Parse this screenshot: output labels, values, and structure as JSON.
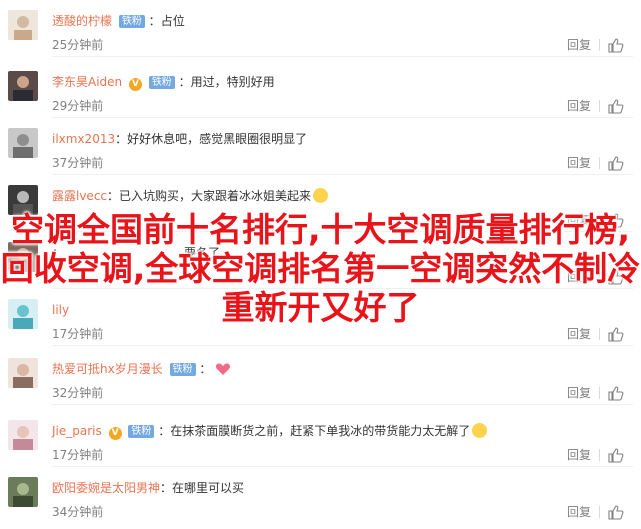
{
  "overlay_title": "空调全国前十名排行,十大空调质量排行榜,回收空调,全球空调排名第一空调突然不制冷重新开又好了",
  "comments": [
    {
      "user": "透酸的柠檬",
      "badge": "铁粉",
      "text": "占位",
      "time": "25分钟前",
      "reply": "回复",
      "like": "赞"
    },
    {
      "user": "李东昊Aiden",
      "vip": "V",
      "badge": "铁粉",
      "text": "用过，特别好用",
      "time": "29分钟前",
      "reply": "回复",
      "like": "赞"
    },
    {
      "user": "ilxmx2013",
      "text": "好好休息吧，感觉黑眼圈很明显了",
      "time": "37分钟前",
      "reply": "回复",
      "like": "赞"
    },
    {
      "user": "露露lvecc",
      "text": "已入坑购买，大家跟着冰冰姐美起来",
      "time": "",
      "reply": "回复",
      "like": "赞"
    },
    {
      "user": "",
      "text": "要冬了",
      "time": "",
      "reply": "回复",
      "like": "赞"
    },
    {
      "user": "lily",
      "text": "",
      "time": "17分钟前",
      "reply": "回复",
      "like": "赞"
    },
    {
      "user": "热爱可抵hx岁月漫长",
      "badge": "铁粉",
      "text": "",
      "time": "32分钟前",
      "reply": "回复",
      "like": "赞"
    },
    {
      "user": "Jie_paris",
      "vip": "V",
      "badge": "铁粉",
      "text": "在抹茶面膜断货之前，赶紧下单我冰的带货能力太无解了",
      "time": "17分钟前",
      "reply": "回复",
      "like": "赞"
    },
    {
      "user": "欧阳委婉是太阳男神",
      "text": "在哪里可以买",
      "time": "34分钟前",
      "reply": "回复",
      "like": "赞"
    }
  ],
  "colors": {
    "username": "#eb7350",
    "badge": "#73a8e0",
    "overlay": "#e8141a"
  },
  "icons": {
    "like": "thumbs-up-icon",
    "emoji_smile": "grin-emoji-icon",
    "emoji_heart": "heart-emoji-icon"
  }
}
